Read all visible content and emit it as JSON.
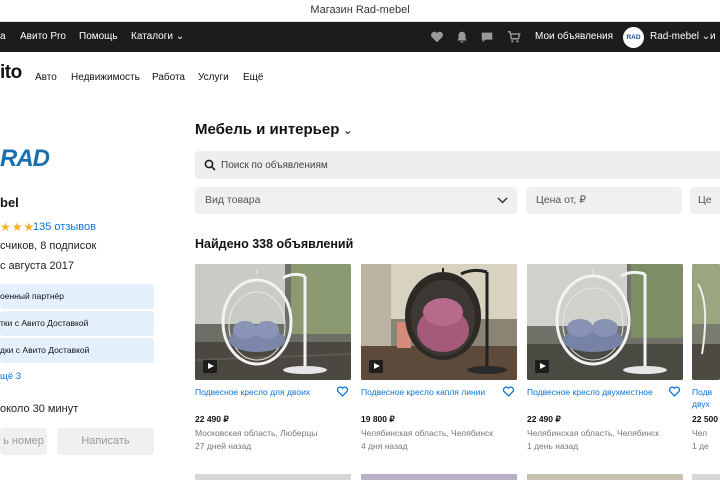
{
  "window": {
    "title": "Магазин Rad-mebel"
  },
  "topnav": {
    "links": [
      "а",
      "Авито Pro",
      "Помощь",
      "Каталоги"
    ],
    "my_ads": "Мои объявления",
    "avatar_text": "RAD",
    "user": "Rad-mebel",
    "icons": [
      "heart-icon",
      "bell-icon",
      "chat-icon",
      "cart-icon",
      "chevron-down-icon"
    ]
  },
  "secnav": {
    "logo": "ito",
    "items": [
      "Авто",
      "Недвижимость",
      "Работа",
      "Услуги",
      "Ещё"
    ]
  },
  "seller": {
    "brand": "RAD",
    "name": "bel",
    "stars": "★★★",
    "reviews": "135 отзывов",
    "followers": "счиков, 8 подписок",
    "since": "с августа 2017",
    "badges": [
      "оенный партнёр",
      "тки с Авито Доставкой",
      "дки с Авито Доставкой"
    ],
    "more_link": "щё 3",
    "response_time": "около 30 минут",
    "show_phone": "ь номер",
    "write": "Написать"
  },
  "main": {
    "heading": "Мебель и интерьер",
    "search_placeholder": "Поиск по объявлениям",
    "filters": {
      "product_type": "Вид товара",
      "price_from": "Цена от, ₽",
      "extra": "Це"
    },
    "found": "Найдено 338 объявлений"
  },
  "listings": [
    {
      "title": "Подвесное кресло для двоих",
      "price": "22 490 ₽",
      "location": "Московская область, Люберцы",
      "date": "27 дней назад"
    },
    {
      "title": "Подвесное кресло капля линии",
      "price": "19 800 ₽",
      "location": "Челябинская область, Челябинск",
      "date": "4 дня назад"
    },
    {
      "title": "Подвесное кресло двухместное",
      "price": "22 490 ₽",
      "location": "Челябинская область, Челябинск",
      "date": "1 день назад"
    },
    {
      "title": "Подв двух",
      "price": "22 500",
      "location": "Чел",
      "date": "1 де"
    }
  ],
  "colors": {
    "link": "#0a74da",
    "topbar": "#1c1c1c",
    "badge_bg": "#e4f1fc",
    "star": "#ffb020",
    "brand": "#1a6fb0"
  }
}
